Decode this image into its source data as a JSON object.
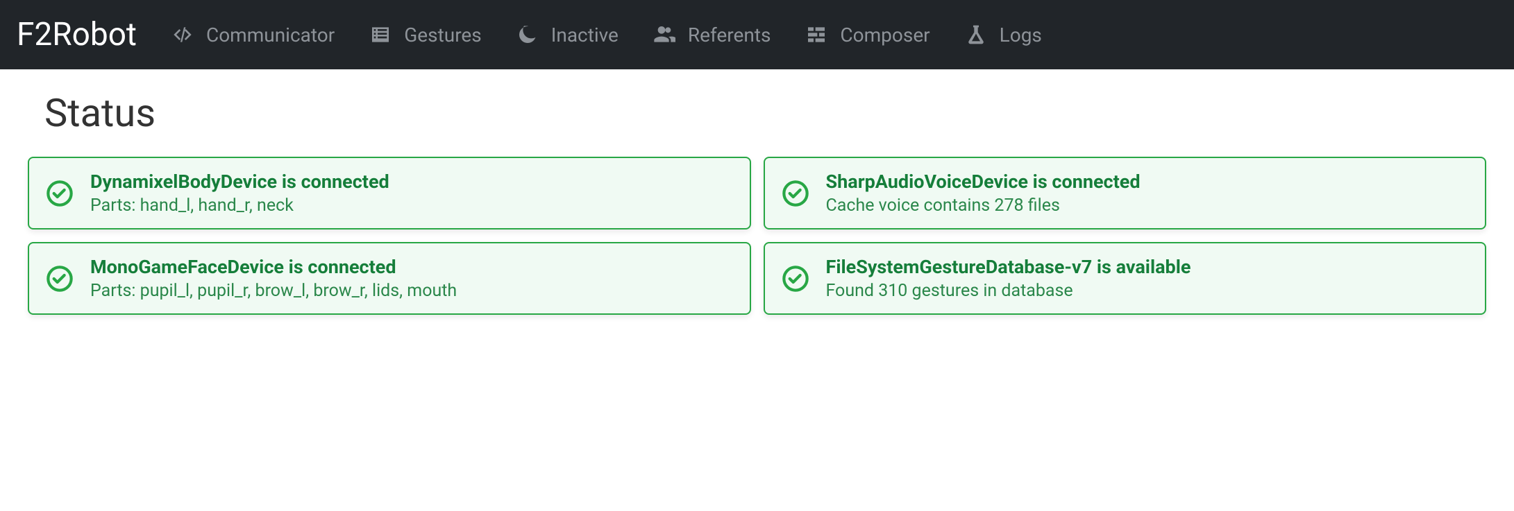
{
  "brand": "F2Robot",
  "nav": [
    {
      "id": "communicator",
      "label": "Communicator",
      "icon": "code-slash-icon"
    },
    {
      "id": "gestures",
      "label": "Gestures",
      "icon": "list-icon"
    },
    {
      "id": "inactive",
      "label": "Inactive",
      "icon": "moon-icon"
    },
    {
      "id": "referents",
      "label": "Referents",
      "icon": "users-icon"
    },
    {
      "id": "composer",
      "label": "Composer",
      "icon": "grid-icon"
    },
    {
      "id": "logs",
      "label": "Logs",
      "icon": "flask-icon"
    }
  ],
  "page_title": "Status",
  "cards": [
    {
      "title": "DynamixelBodyDevice is connected",
      "desc": "Parts: hand_l, hand_r, neck"
    },
    {
      "title": "SharpAudioVoiceDevice is connected",
      "desc": "Cache voice contains 278 files"
    },
    {
      "title": "MonoGameFaceDevice is connected",
      "desc": "Parts: pupil_l, pupil_r, brow_l, brow_r, lids, mouth"
    },
    {
      "title": "FileSystemGestureDatabase-v7 is available",
      "desc": "Found 310 gestures in database"
    }
  ]
}
